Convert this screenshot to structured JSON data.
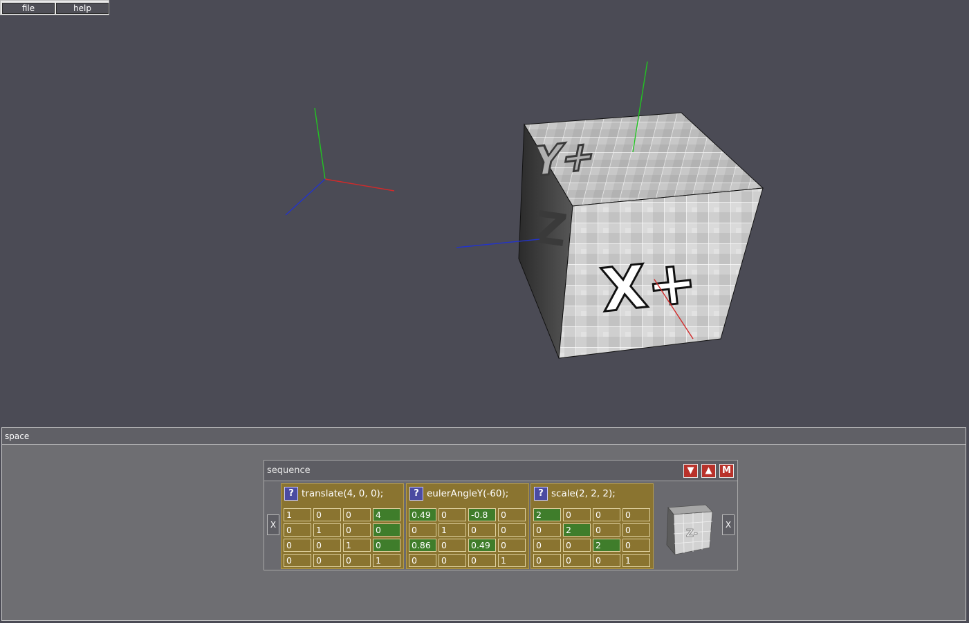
{
  "menu": {
    "file": "file",
    "help": "help"
  },
  "viewport": {
    "cube_faces": {
      "top": "Y+",
      "front": "X+",
      "side": "Z-"
    },
    "axis_colors": {
      "x": "#d22a2a",
      "y": "#22c422",
      "z": "#2233cc"
    }
  },
  "panel": {
    "title": "space"
  },
  "sequence": {
    "title": "sequence",
    "buttons": {
      "down": "▼",
      "up": "▲",
      "m": "M"
    },
    "remove_left": "X",
    "remove_right": "X",
    "help_label": "?",
    "transforms": [
      {
        "label": "translate(4, 0, 0);",
        "matrix": [
          [
            "1",
            "0",
            "0",
            "4"
          ],
          [
            "0",
            "1",
            "0",
            "0"
          ],
          [
            "0",
            "0",
            "1",
            "0"
          ],
          [
            "0",
            "0",
            "0",
            "1"
          ]
        ],
        "active": [
          [
            false,
            false,
            false,
            true
          ],
          [
            false,
            false,
            false,
            true
          ],
          [
            false,
            false,
            false,
            true
          ],
          [
            false,
            false,
            false,
            false
          ]
        ]
      },
      {
        "label": "eulerAngleY(-60);",
        "matrix": [
          [
            "0.49",
            "0",
            "-0.8",
            "0"
          ],
          [
            "0",
            "1",
            "0",
            "0"
          ],
          [
            "0.86",
            "0",
            "0.49",
            "0"
          ],
          [
            "0",
            "0",
            "0",
            "1"
          ]
        ],
        "active": [
          [
            true,
            false,
            true,
            false
          ],
          [
            false,
            false,
            false,
            false
          ],
          [
            true,
            false,
            true,
            false
          ],
          [
            false,
            false,
            false,
            false
          ]
        ]
      },
      {
        "label": "scale(2, 2, 2);",
        "matrix": [
          [
            "2",
            "0",
            "0",
            "0"
          ],
          [
            "0",
            "2",
            "0",
            "0"
          ],
          [
            "0",
            "0",
            "2",
            "0"
          ],
          [
            "0",
            "0",
            "0",
            "1"
          ]
        ],
        "active": [
          [
            true,
            false,
            false,
            false
          ],
          [
            false,
            true,
            false,
            false
          ],
          [
            false,
            false,
            true,
            false
          ],
          [
            false,
            false,
            false,
            false
          ]
        ]
      }
    ],
    "thumbnail_label": "Z-"
  }
}
